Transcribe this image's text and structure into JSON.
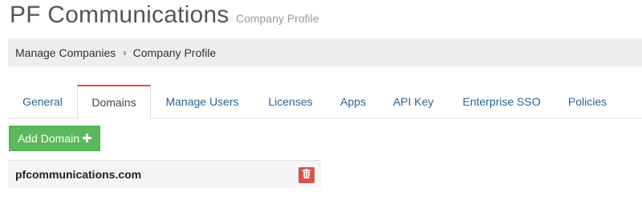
{
  "header": {
    "title": "PF Communications",
    "subtitle": "Company Profile"
  },
  "breadcrumb": {
    "items": [
      "Manage Companies",
      "Company Profile"
    ],
    "separator": "›"
  },
  "tabs": [
    {
      "label": "General",
      "active": false
    },
    {
      "label": "Domains",
      "active": true
    },
    {
      "label": "Manage Users",
      "active": false
    },
    {
      "label": "Licenses",
      "active": false
    },
    {
      "label": "Apps",
      "active": false
    },
    {
      "label": "API Key",
      "active": false
    },
    {
      "label": "Enterprise SSO",
      "active": false
    },
    {
      "label": "Policies",
      "active": false
    }
  ],
  "toolbar": {
    "add_domain_label": "Add Domain",
    "add_icon": "plus-icon"
  },
  "domains": [
    {
      "name": "pfcommunications.com",
      "delete_icon": "trash-icon"
    }
  ],
  "colors": {
    "accent_active_tab": "#d9534f",
    "link": "#2a6496",
    "success_button": "#5cb85c",
    "danger_button": "#d9534f",
    "breadcrumb_bg": "#eeeeee"
  }
}
